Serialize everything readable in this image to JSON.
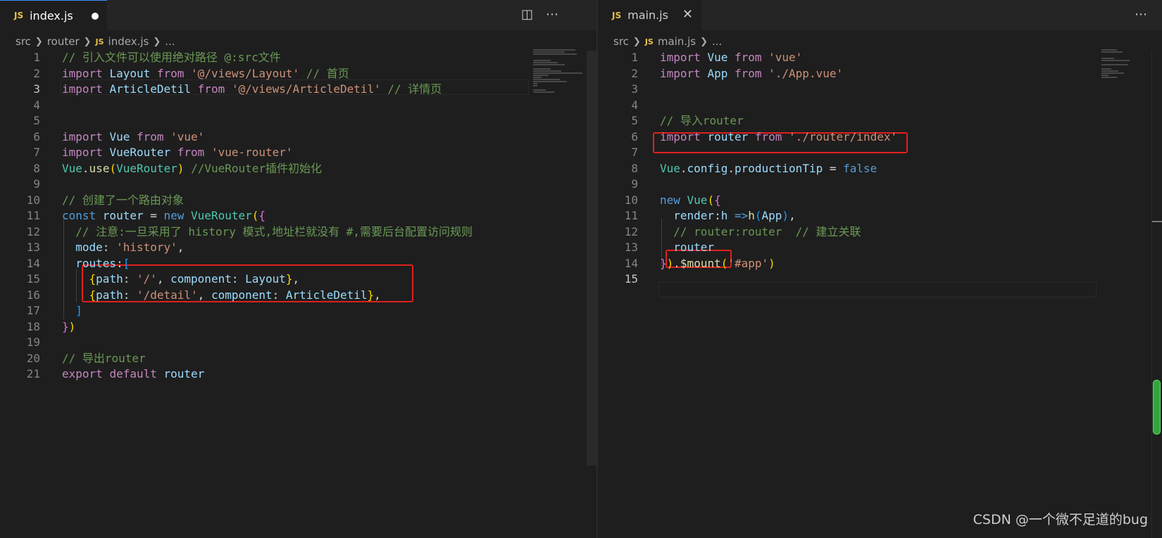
{
  "left": {
    "tab": {
      "badge": "JS",
      "label": "index.js"
    },
    "breadcrumb": [
      "src",
      "router",
      "index.js",
      "..."
    ],
    "breadcrumb_badge": "JS",
    "line_numbers": [
      "1",
      "2",
      "3",
      "4",
      "5",
      "6",
      "7",
      "8",
      "9",
      "10",
      "11",
      "12",
      "13",
      "14",
      "15",
      "16",
      "17",
      "18",
      "19",
      "20",
      "21"
    ],
    "code": [
      [
        {
          "t": "// 引入文件可以使用绝对路径 @:src文件",
          "c": "com"
        }
      ],
      [
        {
          "t": "import ",
          "c": "kw"
        },
        {
          "t": "Layout ",
          "c": "var"
        },
        {
          "t": "from ",
          "c": "kw"
        },
        {
          "t": "'@/views/Layout'",
          "c": "str"
        },
        {
          "t": " // 首页",
          "c": "com"
        }
      ],
      [
        {
          "t": "import ",
          "c": "kw"
        },
        {
          "t": "ArticleDetil ",
          "c": "var"
        },
        {
          "t": "from ",
          "c": "kw"
        },
        {
          "t": "'@/views/ArticleDetil'",
          "c": "str"
        },
        {
          "t": " // 详情页",
          "c": "com"
        }
      ],
      [],
      [],
      [
        {
          "t": "import ",
          "c": "kw"
        },
        {
          "t": "Vue ",
          "c": "var"
        },
        {
          "t": "from ",
          "c": "kw"
        },
        {
          "t": "'vue'",
          "c": "str"
        }
      ],
      [
        {
          "t": "import ",
          "c": "kw"
        },
        {
          "t": "VueRouter ",
          "c": "var"
        },
        {
          "t": "from ",
          "c": "kw"
        },
        {
          "t": "'vue-router'",
          "c": "str"
        }
      ],
      [
        {
          "t": "Vue",
          "c": "cls"
        },
        {
          "t": ".",
          "c": "txt"
        },
        {
          "t": "use",
          "c": "fn"
        },
        {
          "t": "(",
          "c": "br1"
        },
        {
          "t": "VueRouter",
          "c": "cls"
        },
        {
          "t": ")",
          "c": "br1"
        },
        {
          "t": " //VueRouter插件初始化",
          "c": "com"
        }
      ],
      [],
      [
        {
          "t": "// 创建了一个路由对象",
          "c": "com"
        }
      ],
      [
        {
          "t": "const ",
          "c": "blue"
        },
        {
          "t": "router ",
          "c": "var"
        },
        {
          "t": "= ",
          "c": "txt"
        },
        {
          "t": "new ",
          "c": "blue"
        },
        {
          "t": "VueRouter",
          "c": "cls"
        },
        {
          "t": "(",
          "c": "br1"
        },
        {
          "t": "{",
          "c": "br2"
        }
      ],
      [
        {
          "t": "  // 注意:一旦采用了 history 模式,地址栏就没有 #,需要后台配置访问规则",
          "c": "com"
        }
      ],
      [
        {
          "t": "  mode",
          "c": "var"
        },
        {
          "t": ": ",
          "c": "txt"
        },
        {
          "t": "'history'",
          "c": "str"
        },
        {
          "t": ",",
          "c": "txt"
        }
      ],
      [
        {
          "t": "  routes",
          "c": "var"
        },
        {
          "t": ":",
          "c": "txt"
        },
        {
          "t": "[",
          "c": "br3"
        }
      ],
      [
        {
          "t": "    ",
          "c": "txt"
        },
        {
          "t": "{",
          "c": "br1"
        },
        {
          "t": "path",
          "c": "var"
        },
        {
          "t": ": ",
          "c": "txt"
        },
        {
          "t": "'/'",
          "c": "str"
        },
        {
          "t": ", ",
          "c": "txt"
        },
        {
          "t": "component",
          "c": "var"
        },
        {
          "t": ": ",
          "c": "txt"
        },
        {
          "t": "Layout",
          "c": "var"
        },
        {
          "t": "}",
          "c": "br1"
        },
        {
          "t": ",",
          "c": "txt"
        }
      ],
      [
        {
          "t": "    ",
          "c": "txt"
        },
        {
          "t": "{",
          "c": "br1"
        },
        {
          "t": "path",
          "c": "var"
        },
        {
          "t": ": ",
          "c": "txt"
        },
        {
          "t": "'/detail'",
          "c": "str"
        },
        {
          "t": ", ",
          "c": "txt"
        },
        {
          "t": "component",
          "c": "var"
        },
        {
          "t": ": ",
          "c": "txt"
        },
        {
          "t": "ArticleDetil",
          "c": "var"
        },
        {
          "t": "}",
          "c": "br1"
        },
        {
          "t": ",",
          "c": "txt"
        }
      ],
      [
        {
          "t": "  ",
          "c": "txt"
        },
        {
          "t": "]",
          "c": "br3"
        }
      ],
      [
        {
          "t": "}",
          "c": "br2"
        },
        {
          "t": ")",
          "c": "br1"
        }
      ],
      [],
      [
        {
          "t": "// 导出router",
          "c": "com"
        }
      ],
      [
        {
          "t": "export ",
          "c": "kw"
        },
        {
          "t": "default ",
          "c": "kw"
        },
        {
          "t": "router",
          "c": "var"
        }
      ]
    ]
  },
  "right": {
    "tab": {
      "badge": "JS",
      "label": "main.js",
      "close": "✕"
    },
    "breadcrumb": [
      "src",
      "main.js",
      "..."
    ],
    "breadcrumb_badge": "JS",
    "line_numbers": [
      "1",
      "2",
      "3",
      "4",
      "5",
      "6",
      "7",
      "8",
      "9",
      "10",
      "11",
      "12",
      "13",
      "14",
      "15"
    ],
    "code": [
      [
        {
          "t": "import ",
          "c": "kw"
        },
        {
          "t": "Vue ",
          "c": "var"
        },
        {
          "t": "from ",
          "c": "kw"
        },
        {
          "t": "'vue'",
          "c": "str"
        }
      ],
      [
        {
          "t": "import ",
          "c": "kw"
        },
        {
          "t": "App ",
          "c": "var"
        },
        {
          "t": "from ",
          "c": "kw"
        },
        {
          "t": "'./App.vue'",
          "c": "str"
        }
      ],
      [],
      [],
      [
        {
          "t": "// 导入router",
          "c": "com"
        }
      ],
      [
        {
          "t": "import ",
          "c": "kw"
        },
        {
          "t": "router ",
          "c": "var"
        },
        {
          "t": "from ",
          "c": "kw"
        },
        {
          "t": "'./router/index'",
          "c": "str"
        }
      ],
      [],
      [
        {
          "t": "Vue",
          "c": "cls"
        },
        {
          "t": ".",
          "c": "txt"
        },
        {
          "t": "config",
          "c": "var"
        },
        {
          "t": ".",
          "c": "txt"
        },
        {
          "t": "productionTip",
          "c": "var"
        },
        {
          "t": " = ",
          "c": "txt"
        },
        {
          "t": "false",
          "c": "blue"
        }
      ],
      [],
      [
        {
          "t": "new ",
          "c": "blue"
        },
        {
          "t": "Vue",
          "c": "cls"
        },
        {
          "t": "(",
          "c": "br1"
        },
        {
          "t": "{",
          "c": "br2"
        }
      ],
      [
        {
          "t": "  render",
          "c": "var"
        },
        {
          "t": ":",
          "c": "txt"
        },
        {
          "t": "h ",
          "c": "var"
        },
        {
          "t": "=>",
          "c": "blue"
        },
        {
          "t": "h",
          "c": "fn"
        },
        {
          "t": "(",
          "c": "br3"
        },
        {
          "t": "App",
          "c": "var"
        },
        {
          "t": ")",
          "c": "br3"
        },
        {
          "t": ",",
          "c": "txt"
        }
      ],
      [
        {
          "t": "  // router:router  // 建立关联",
          "c": "com"
        }
      ],
      [
        {
          "t": "  router",
          "c": "var"
        }
      ],
      [
        {
          "t": "}",
          "c": "br2"
        },
        {
          "t": ")",
          "c": "br1"
        },
        {
          "t": ".",
          "c": "txt"
        },
        {
          "t": "$mount",
          "c": "fn"
        },
        {
          "t": "(",
          "c": "br1"
        },
        {
          "t": "'#app'",
          "c": "str"
        },
        {
          "t": ")",
          "c": "br1"
        }
      ],
      []
    ]
  },
  "icons": {
    "split_editor": "split-editor-icon",
    "more_actions": "more-actions-icon",
    "close": "close-icon",
    "chevron": "chevron-right-icon"
  },
  "colors": {
    "highlight_box": "#e0201d",
    "tab_accent": "#3794ff",
    "js_badge": "#e8c14b"
  },
  "watermark": "CSDN @一个微不足道的bug"
}
